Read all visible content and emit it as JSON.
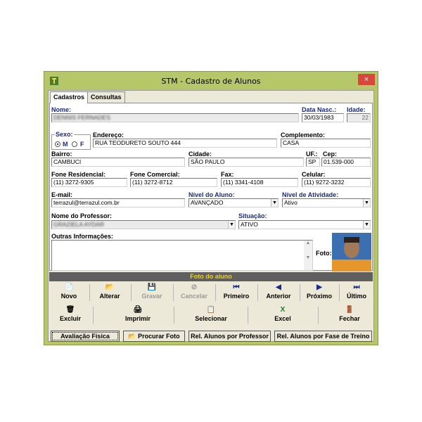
{
  "window": {
    "title": "STM - Cadastro de Alunos",
    "close_label": "×"
  },
  "tabs": [
    {
      "label": "Cadastros",
      "active": true
    },
    {
      "label": "Consultas",
      "active": false
    }
  ],
  "form": {
    "nome": {
      "label": "Nome:",
      "value": "DENNIS FERNADES"
    },
    "data_nasc": {
      "label": "Data Nasc.:",
      "value": "30/03/1983"
    },
    "idade": {
      "label": "Idade:",
      "value": "22"
    },
    "sexo": {
      "label": "Sexo:",
      "options": [
        "M",
        "F"
      ],
      "selected": "M"
    },
    "endereco": {
      "label": "Endereço:",
      "value": "RUA TEODURETO SOUTO 444"
    },
    "complemento": {
      "label": "Complemento:",
      "value": "CASA"
    },
    "bairro": {
      "label": "Bairro:",
      "value": "CAMBUCI"
    },
    "cidade": {
      "label": "Cidade:",
      "value": "SÃO PAULO"
    },
    "uf": {
      "label": "UF.:",
      "value": "SP"
    },
    "cep": {
      "label": "Cep:",
      "value": "01.539-000"
    },
    "fone_residencial": {
      "label": "Fone Residencial:",
      "value": "(11) 3272-9305"
    },
    "fone_comercial": {
      "label": "Fone Comercial:",
      "value": "(11) 3272-8712"
    },
    "fax": {
      "label": "Fax:",
      "value": "(11) 3341-4108"
    },
    "celular": {
      "label": "Celular:",
      "value": "(11) 9272-3232"
    },
    "email": {
      "label": "E-mail:",
      "value": "terrazul@terrazul.com.br"
    },
    "nivel_aluno": {
      "label": "Nível do Aluno:",
      "value": "AVANÇADO"
    },
    "nivel_atividade": {
      "label": "Nível de Atividade:",
      "value": "Ativo"
    },
    "professor": {
      "label": "Nome do Professor:",
      "value": "GRAZIELA AYDAR"
    },
    "situacao": {
      "label": "Situação:",
      "value": "ATIVO"
    },
    "outras": {
      "label": "Outras Informações:",
      "value": ""
    },
    "foto": {
      "label": "Foto:"
    }
  },
  "photo_strip": "Foto do aluno",
  "nav_buttons": [
    {
      "label": "Novo",
      "icon": "📄",
      "enabled": true
    },
    {
      "label": "Alterar",
      "icon": "📂",
      "enabled": true
    },
    {
      "label": "Gravar",
      "icon": "💾",
      "enabled": false
    },
    {
      "label": "Cancelar",
      "icon": "⊘",
      "enabled": false
    },
    {
      "label": "Primeiro",
      "icon": "⏮",
      "enabled": true
    },
    {
      "label": "Anterior",
      "icon": "◀",
      "enabled": true
    },
    {
      "label": "Próximo",
      "icon": "▶",
      "enabled": true
    },
    {
      "label": "Último",
      "icon": "⏭",
      "enabled": true
    }
  ],
  "action_buttons": [
    {
      "label": "Excluir",
      "icon": "🗑"
    },
    {
      "label": "Imprimir",
      "icon": "🖨"
    },
    {
      "label": "Selecionar",
      "icon": "📋"
    },
    {
      "label": "Excel",
      "icon": "X"
    },
    {
      "label": "Fechar",
      "icon": "🚪"
    }
  ],
  "bottom_buttons": [
    {
      "label": "Avaliação Física"
    },
    {
      "label": "Procurar Foto",
      "icon": "📂"
    },
    {
      "label": "Rel. Alunos por Professor"
    },
    {
      "label": "Rel. Alunos por Fase de Treino"
    }
  ],
  "colors": {
    "frame": "#b6c76a",
    "panel": "#ece9d8",
    "label_blue": "#1a2a8c",
    "strip_bg": "#5f5f5f",
    "strip_text": "#f2d200",
    "close": "#d9463a"
  }
}
